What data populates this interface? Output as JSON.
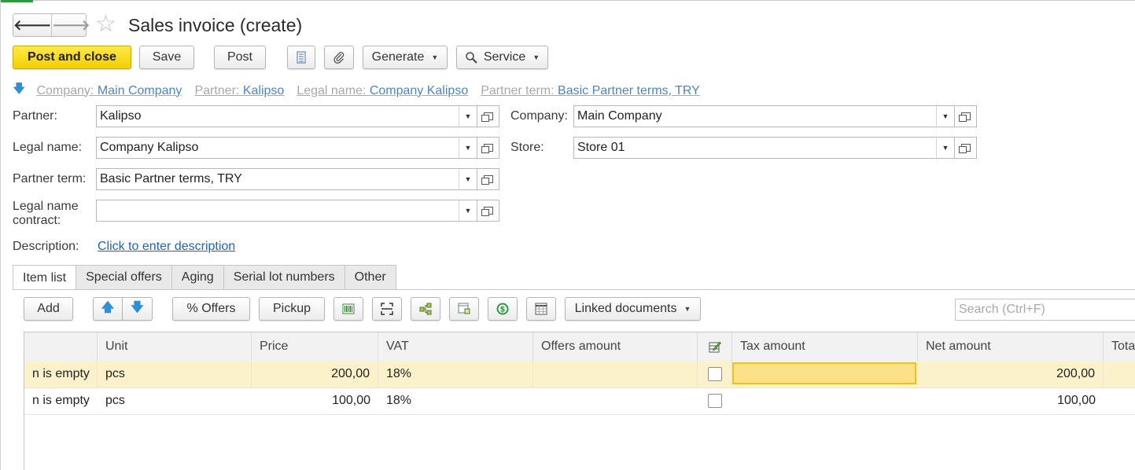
{
  "window": {
    "title": "Sales invoice (create)",
    "nav_back": "🡐",
    "nav_forward": "🡒",
    "favorite_icon": "star-icon"
  },
  "toolbar": {
    "post_and_close": "Post and close",
    "save": "Save",
    "post": "Post",
    "generate": "Generate",
    "service": "Service"
  },
  "header_links": {
    "company_label": "Company:",
    "company_value": "Main Company",
    "partner_label": "Partner:",
    "partner_value": "Kalipso",
    "legal_name_label": "Legal name:",
    "legal_name_value": "Company Kalipso",
    "partner_term_label": "Partner term:",
    "partner_term_value": "Basic Partner terms, TRY"
  },
  "form": {
    "partner_label": "Partner:",
    "partner_value": "Kalipso",
    "legal_name_label": "Legal name:",
    "legal_name_value": "Company Kalipso",
    "partner_term_label": "Partner term:",
    "partner_term_value": "Basic Partner terms, TRY",
    "legal_contract_label_1": "Legal name",
    "legal_contract_label_2": "contract:",
    "legal_contract_value": "",
    "company_label": "Company:",
    "company_value": "Main Company",
    "store_label": "Store:",
    "store_value": "Store 01",
    "description_label": "Description:",
    "description_link": "Click to enter description"
  },
  "tabs": [
    "Item list",
    "Special offers",
    "Aging",
    "Serial lot numbers",
    "Other"
  ],
  "item_toolbar": {
    "add": "Add",
    "offers": "% Offers",
    "pickup": "Pickup",
    "linked_documents": "Linked documents",
    "search_placeholder": "Search (Ctrl+F)"
  },
  "table": {
    "columns": [
      "",
      "Unit",
      "Price",
      "VAT",
      "Offers amount",
      "",
      "Tax amount",
      "Net amount",
      "Total"
    ],
    "rows": [
      {
        "item": "n is empty",
        "unit": "pcs",
        "price": "200,00",
        "vat": "18%",
        "offers": "",
        "tax": "",
        "net": "200,00",
        "total": ""
      },
      {
        "item": "n is empty",
        "unit": "pcs",
        "price": "100,00",
        "vat": "18%",
        "offers": "",
        "tax": "",
        "net": "100,00",
        "total": ""
      }
    ]
  },
  "colors": {
    "primary_button": "#f5d400",
    "link": "#1f63b5",
    "selected_row": "#fbf2cb",
    "active_cell_border": "#f1c21a"
  }
}
